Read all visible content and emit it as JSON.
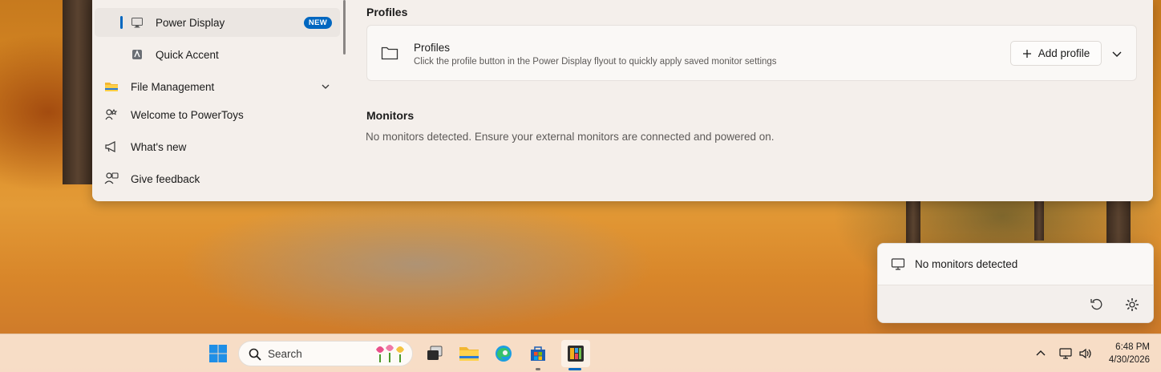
{
  "nav": {
    "items": [
      {
        "label": "Power Display",
        "badge": "NEW",
        "icon": "monitor-icon",
        "selected": true
      },
      {
        "label": "Quick Accent",
        "icon": "quick-accent-icon"
      },
      {
        "label": "File Management",
        "icon": "folder-icon",
        "expandable": true
      },
      {
        "label": "Welcome to PowerToys",
        "icon": "welcome-icon"
      },
      {
        "label": "What's new",
        "icon": "megaphone-icon"
      },
      {
        "label": "Give feedback",
        "icon": "feedback-icon"
      }
    ]
  },
  "content": {
    "profiles_section_title": "Profiles",
    "profiles_card": {
      "title": "Profiles",
      "description": "Click the profile button in the Power Display flyout to quickly apply saved monitor settings",
      "add_button_label": "Add profile"
    },
    "monitors_section_title": "Monitors",
    "monitors_empty_message": "No monitors detected. Ensure your external monitors are connected and powered on."
  },
  "flyout": {
    "message": "No monitors detected",
    "actions": [
      "refresh-icon",
      "settings-icon"
    ]
  },
  "taskbar": {
    "search_label": "Search",
    "time": "6:48 PM",
    "date": "4/30/2026"
  },
  "colors": {
    "accent": "#0067c0",
    "window_bg": "#f4efeb"
  }
}
